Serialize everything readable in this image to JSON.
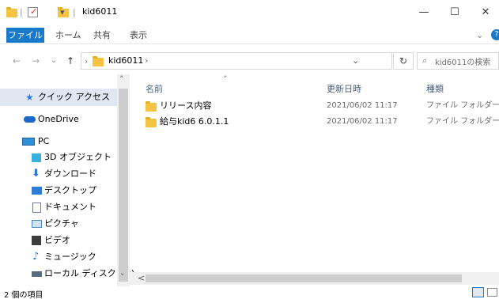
{
  "window": {
    "title": "kid6011",
    "minimize_glyph": "—",
    "maximize_glyph": "☐",
    "close_glyph": "✕",
    "qa_separator": "|",
    "qa_dropdown": "▾"
  },
  "ribbon": {
    "tabs": [
      "ファイル",
      "ホーム",
      "共有",
      "表示"
    ],
    "expand_glyph": "⌄",
    "help_glyph": "?"
  },
  "address": {
    "back": "←",
    "forward": "→",
    "dropdown": "⌄",
    "up": "↑",
    "sep1": "›",
    "path": "kid6011",
    "sep2": "›",
    "history_dropdown": "⌄",
    "refresh": "↻",
    "search_placeholder": "kid6011の検索"
  },
  "navpane": {
    "items": [
      {
        "label": "クイック アクセス",
        "icon": "star-icon",
        "color": "#2f7bd8"
      },
      {
        "label": "OneDrive",
        "icon": "cloud-icon",
        "color": "#1e66c8"
      },
      {
        "label": "PC",
        "icon": "pc-icon",
        "color": "#2f8fd8"
      },
      {
        "label": "3D オブジェクト",
        "icon": "cube-icon",
        "color": "#3ab0e0"
      },
      {
        "label": "ダウンロード",
        "icon": "download-icon",
        "color": "#2f7bd8"
      },
      {
        "label": "デスクトップ",
        "icon": "desktop-icon",
        "color": "#2f7bd8"
      },
      {
        "label": "ドキュメント",
        "icon": "document-icon",
        "color": "#6b7f99"
      },
      {
        "label": "ピクチャ",
        "icon": "pictures-icon",
        "color": "#4b88c8"
      },
      {
        "label": "ビデオ",
        "icon": "video-icon",
        "color": "#3d3d3d"
      },
      {
        "label": "ミュージック",
        "icon": "music-icon",
        "color": "#2f7bd8"
      },
      {
        "label": "ローカル ディスク (C:)",
        "icon": "drive-icon",
        "color": "#5a6b80"
      }
    ]
  },
  "scroll": {
    "up": "˄",
    "down": "˅",
    "left": "<"
  },
  "content": {
    "sort_indicator": "˄",
    "columns": [
      "名前",
      "更新日時",
      "種類"
    ],
    "rows": [
      {
        "name": "リリース内容",
        "date": "2021/06/02 11:17",
        "type": "ファイル フォルダー"
      },
      {
        "name": "給与kid6 6.0.1.1",
        "date": "2021/06/02 11:17",
        "type": "ファイル フォルダー"
      }
    ]
  },
  "status": {
    "item_count": "2 個の項目"
  },
  "colors": {
    "accent": "#1979ca",
    "selection": "#dfe8f2",
    "folder": "#f5c342"
  }
}
